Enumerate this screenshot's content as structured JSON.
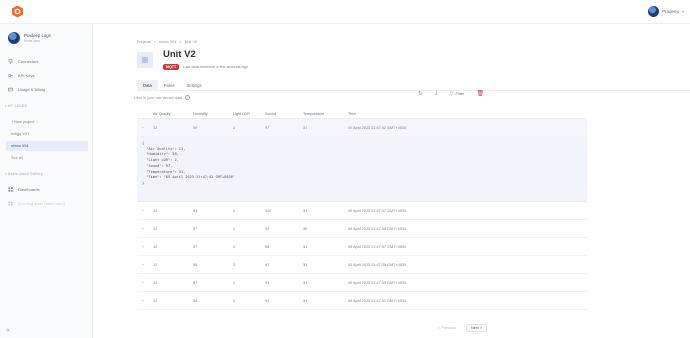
{
  "topbar": {
    "user_name": "Pradeep"
  },
  "sidebar": {
    "profile_name": "Pradeep Logs",
    "profile_role": "Invite also",
    "items": [
      {
        "label": "Connectors",
        "icon": "plug-icon"
      },
      {
        "label": "API Keys",
        "icon": "key-icon"
      },
      {
        "label": "Usage & Billing",
        "icon": "card-icon"
      }
    ],
    "projects_section": "• MY LAKES",
    "project_links": [
      {
        "label": "+ New project"
      },
      {
        "label": "Indigo WIT"
      },
      {
        "label": "simon 904"
      },
      {
        "label": "See all"
      }
    ],
    "dashboards_section": "• Users cloud Gallery",
    "dashboard_items": [
      {
        "label": "Dashboards",
        "icon": "grid-icon"
      },
      {
        "label": "(Coming soon Dashboard)",
        "icon": "grid-icon"
      }
    ]
  },
  "breadcrumb": [
    "Projects",
    ">",
    "simon 904",
    ">",
    "Unit V2"
  ],
  "device": {
    "title": "Unit V2",
    "badge": "MQTT",
    "last_received": "Last data received: a few seconds ago"
  },
  "tabs": [
    {
      "label": "Data",
      "active": true
    },
    {
      "label": "Rules",
      "active": false
    },
    {
      "label": "Settings",
      "active": false
    }
  ],
  "hint": "Here is your raw device data",
  "toolbar": {
    "filter_label": "Filter"
  },
  "table": {
    "headers": [
      "Air Quality",
      "Humidity",
      "Light LDR",
      "Sound",
      "Temperature",
      "Time"
    ],
    "expanded_row": {
      "air": "13",
      "humidity": "59",
      "light": "2",
      "sound": "97",
      "temp": "31",
      "time": "05 April 2023 21:47:42 GMT+0530"
    },
    "json_text": "{\n  \"Air Quality\": 13,\n  \"Humidity\": 58,\n  \"Light LDR\": 2,\n  \"Sound\": 97,\n  \"Temperature\": 31,\n  \"Time\": \"05 April 2023 21:47:42 GMT+0530\"\n}",
    "rows": [
      {
        "air": "12",
        "humidity": "61",
        "light": "3",
        "sound": "102",
        "temp": "31",
        "time": "05 April 2023 21:47:47 GMT+0530"
      },
      {
        "air": "12",
        "humidity": "57",
        "light": "2",
        "sound": "92",
        "temp": "30",
        "time": "05 April 2023 21:47:38 GMT+0530"
      },
      {
        "air": "12",
        "humidity": "57",
        "light": "3",
        "sound": "98",
        "temp": "31",
        "time": "05 April 2023 21:47:37 GMT+0530"
      },
      {
        "air": "12",
        "humidity": "58",
        "light": "3",
        "sound": "97",
        "temp": "31",
        "time": "05 April 2023 21:47:35 GMT+0530"
      },
      {
        "air": "12",
        "humidity": "57",
        "light": "2",
        "sound": "93",
        "temp": "31",
        "time": "05 April 2023 21:47:33 GMT+0530"
      },
      {
        "air": "12",
        "humidity": "58",
        "light": "3",
        "sound": "93",
        "temp": "31",
        "time": "05 April 2023 21:47:31 GMT+0530"
      }
    ]
  },
  "pager": {
    "previous": "< Previous",
    "next": "Next >"
  },
  "colors": {
    "accent": "#2f55b7",
    "danger": "#d23a42",
    "badge_bg": "#d23a42"
  }
}
